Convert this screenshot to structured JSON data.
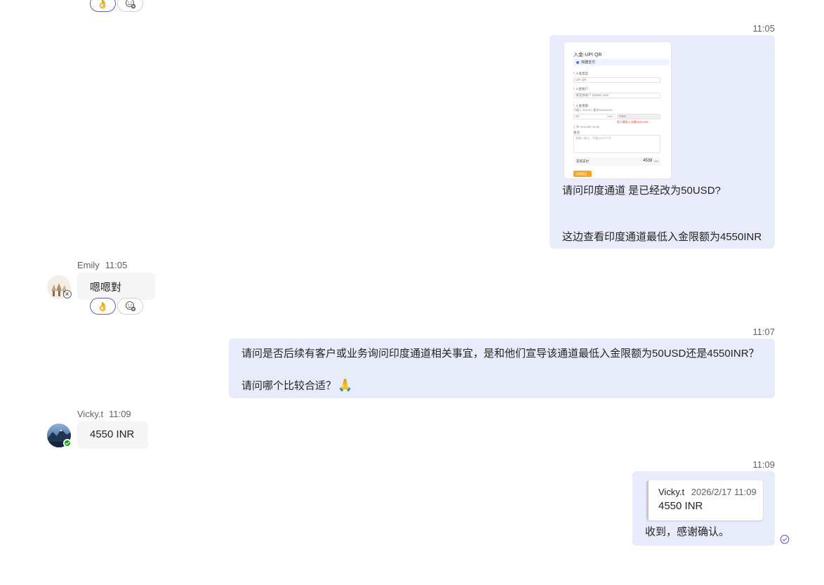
{
  "messages": {
    "m1": {
      "time": "11:05",
      "screenshot": {
        "title": "入金-UPI QR",
        "tag": "快捷支付",
        "field1_label": "* 入金类型",
        "field1_value": "UPI QR",
        "field2_label": "* 入金账户",
        "field2_value": "请选择账户 50389 USD",
        "field3_label": "* 入金金额",
        "field3_hint": "可输入 50USD, 最多50000USD",
        "field3_input": "50",
        "field3_unit": "USD",
        "field3_select": "4550",
        "field3_error": "低于最低入金额4550 INR",
        "rate_text": "汇率 USD/INR 90.86",
        "remark_label": "备注",
        "remark_placeholder": "请输入备注，不超过200个字",
        "total_label": "实际支付",
        "total_value": "4539",
        "total_unit": "INR",
        "submit_label": "立即提交"
      },
      "line1": "请问印度通道 是已经改为50USD?",
      "line2": "这边查看印度通道最低入金限额为4550INR"
    },
    "m2": {
      "sender": "Emily",
      "time": "11:05",
      "text": "嗯嗯對"
    },
    "m3": {
      "time": "11:07",
      "line1": "请问是否后续有客户或业务询问印度通道相关事宜，是和他们宣导该通道最低入金限额为50USD还是4550INR？",
      "line2": "请问哪个比较合适？"
    },
    "m4": {
      "sender": "Vicky.t",
      "time": "11:09",
      "text": "4550 INR"
    },
    "m5": {
      "time": "11:09",
      "quote_sender": "Vicky.t",
      "quote_time": "2026/2/17 11:09",
      "quote_text": "4550 INR",
      "text": "收到，感谢确认。"
    }
  },
  "icons": {
    "ok-hand": "ok-hand-icon",
    "add-reaction": "add-reaction-icon",
    "folded-hands": "folded-hands-icon",
    "seen": "seen-check-icon"
  },
  "colors": {
    "outgoing_bubble": "#e8ebfa",
    "incoming_bubble": "#f5f5f5",
    "accent": "#5b5fc7",
    "online": "#13a10e",
    "submit": "#f5a623"
  }
}
